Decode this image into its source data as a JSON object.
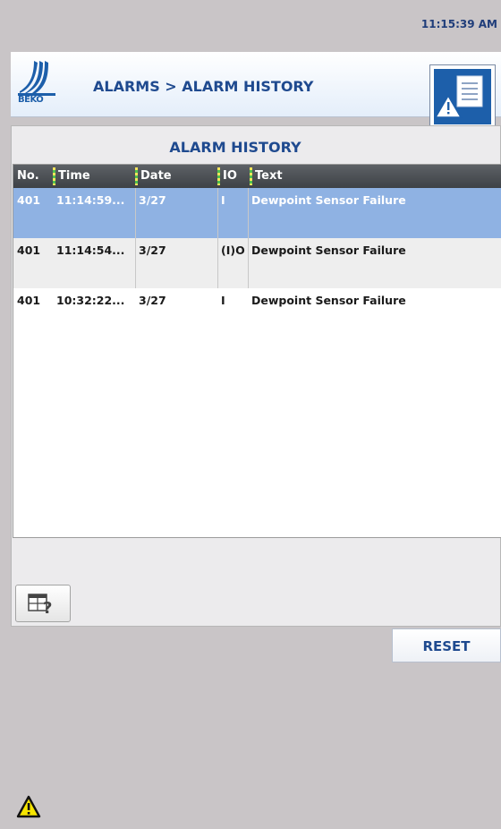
{
  "status_bar": {
    "time": "11:15:39 AM"
  },
  "header": {
    "logo_text": "BEKO",
    "breadcrumb": "ALARMS > ALARM HISTORY"
  },
  "panel": {
    "title": "ALARM HISTORY",
    "columns": [
      "No.",
      "Time",
      "Date",
      "IO",
      "Text"
    ],
    "rows": [
      {
        "no": "401",
        "time": "11:14:59...",
        "date": "3/27",
        "io": "I",
        "text": "Dewpoint Sensor Failure",
        "selected": true
      },
      {
        "no": "401",
        "time": "11:14:54...",
        "date": "3/27",
        "io": "(I)O",
        "text": "Dewpoint Sensor Failure",
        "selected": false
      },
      {
        "no": "401",
        "time": "10:32:22...",
        "date": "3/27",
        "io": "I",
        "text": "Dewpoint Sensor Failure",
        "selected": false
      }
    ]
  },
  "buttons": {
    "reset_label": "RESET"
  },
  "icons": {
    "report": "alarm-report-icon",
    "help": "table-help-icon",
    "warning": "warning-icon"
  },
  "colors": {
    "accent": "#1f4a8f",
    "selected_row": "#8fb2e3",
    "row_shade": "#eeeeee",
    "header_bg": "#4b4f54"
  }
}
